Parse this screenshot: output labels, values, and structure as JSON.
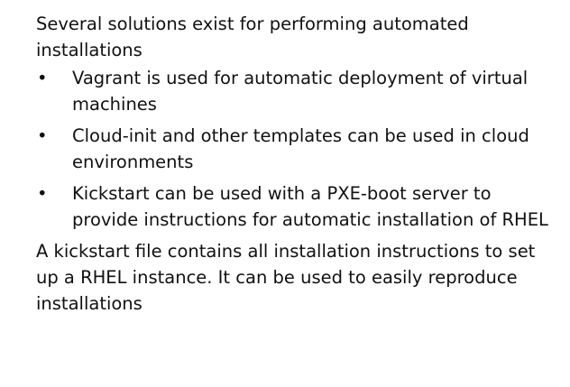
{
  "intro": "Several solutions exist for performing automated installations",
  "bullet_symbol": "•",
  "bullets": [
    {
      "text": "Vagrant is used for automatic deployment of virtual machines"
    },
    {
      "text": "Cloud-init and other templates can be used in cloud environments"
    },
    {
      "text": "Kickstart can be used with a PXE-boot server to provide instructions for automatic installation of RHEL"
    }
  ],
  "closing": "A kickstart file contains all installation instructions to set up a RHEL instance. It can be used to easily reproduce installations"
}
